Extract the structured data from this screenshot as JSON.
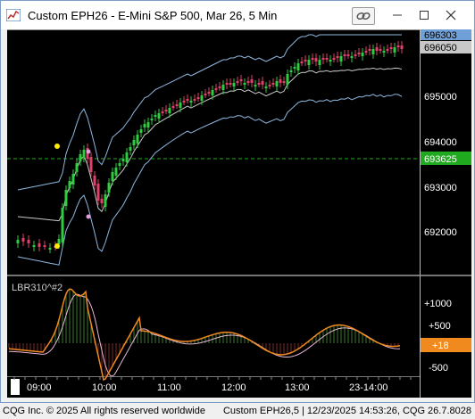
{
  "window": {
    "title": "Custom EPH26 - E-Mini S&P 500, Mar 26, 5 Min"
  },
  "colors": {
    "background": "#000000",
    "candle_up": "#2ecc40",
    "candle_down": "#e0406a",
    "band": "#8fb8e0",
    "midline": "#c8c8c8",
    "price_line": "#22cc22",
    "price_tag": "#1faa1f",
    "oscillator_line": "#f08a1e",
    "oscillator_signal": "#e8b8d8",
    "last_price_tag": "#b0b0b0",
    "band_tag": "#6fa0d8",
    "osc_tag": "#f08a1e"
  },
  "price_axis": {
    "labels": [
      "695000",
      "694000",
      "693000",
      "692000"
    ],
    "top_band_tag": "696303",
    "last_price_tag": "696050",
    "horizontal_line_tag": "693625"
  },
  "oscillator": {
    "label": "LBR310^#2",
    "axis_labels": [
      "+1000",
      "+500",
      "-500"
    ],
    "value_tag": "+18"
  },
  "time_axis": {
    "labels": [
      "09:00",
      "10:00",
      "11:00",
      "12:00",
      "13:00",
      "23-14:00"
    ]
  },
  "footer": {
    "left": "CQG Inc. © 2025 All rights reserved worldwide",
    "right": "Custom EPH26,5 | 12/23/2025 14:53:26, CQG 26.7.8028"
  }
}
